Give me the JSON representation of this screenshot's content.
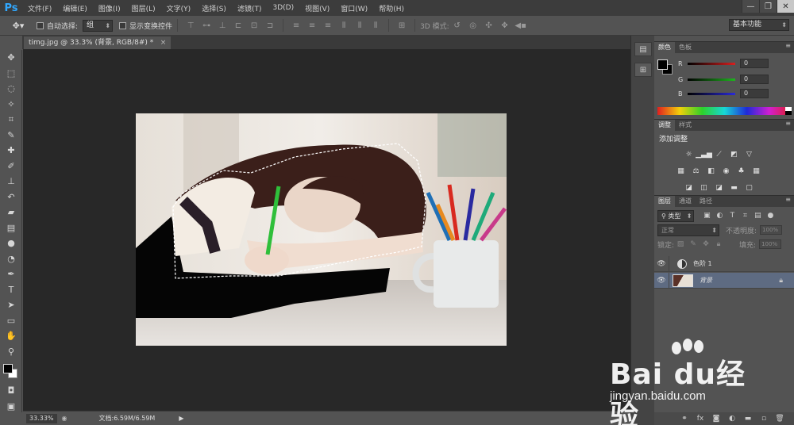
{
  "app": {
    "logo": "Ps"
  },
  "menu": [
    "文件(F)",
    "编辑(E)",
    "图像(I)",
    "图层(L)",
    "文字(Y)",
    "选择(S)",
    "滤镜(T)",
    "3D(D)",
    "视图(V)",
    "窗口(W)",
    "帮助(H)"
  ],
  "window_controls": {
    "minimize": "—",
    "restore": "❐",
    "close": "✕"
  },
  "options": {
    "auto_select_label": "自动选择:",
    "auto_select_value": "组",
    "show_transform_label": "显示变换控件",
    "mode_3d_label": "3D 模式:",
    "workspace": "基本功能"
  },
  "document": {
    "tab_title": "timg.jpg @ 33.3% (背景, RGB/8#) *",
    "tab_close": "×"
  },
  "status": {
    "zoom": "33.33%",
    "doc_info": "文档:6.59M/6.59M"
  },
  "color_panel": {
    "tabs": [
      "颜色",
      "色板"
    ],
    "channels": [
      {
        "label": "R",
        "value": "0",
        "color": "#d81f1f"
      },
      {
        "label": "G",
        "value": "0",
        "color": "#1fb41f"
      },
      {
        "label": "B",
        "value": "0",
        "color": "#2a2ad8"
      }
    ]
  },
  "adjust_panel": {
    "tabs": [
      "调整",
      "样式"
    ],
    "title": "添加调整"
  },
  "layers_panel": {
    "tabs": [
      "图层",
      "通道",
      "路径"
    ],
    "filter_type": "类型",
    "blend_mode": "正常",
    "opacity_label": "不透明度:",
    "opacity_value": "100%",
    "lock_label": "锁定:",
    "fill_label": "填充:",
    "fill_value": "100%",
    "layers": [
      {
        "name": "色阶 1",
        "kind": "adjustment",
        "selected": false
      },
      {
        "name": "背景",
        "kind": "image",
        "selected": true,
        "locked": true
      }
    ]
  },
  "watermark": {
    "brand": "Bai du经验",
    "url": "jingyan.baidu.com"
  }
}
